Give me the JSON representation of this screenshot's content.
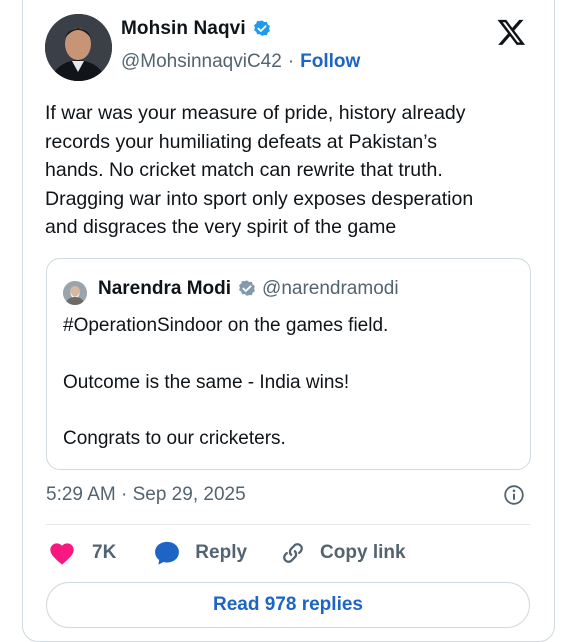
{
  "author": {
    "name": "Mohsin Naqvi",
    "handle": "@MohsinnaqviC42",
    "separator": "·",
    "follow_label": "Follow"
  },
  "tweet": {
    "lines": [
      "If war was your measure of pride, history already",
      "records your humiliating defeats at Pakistan’s",
      "hands. No cricket match can rewrite that truth.",
      "Dragging war into sport only exposes desperation",
      "and disgraces the very spirit of the game"
    ]
  },
  "quoted": {
    "name": "Narendra Modi",
    "handle": "@narendramodi",
    "lines": [
      "#OperationSindoor on the games field.",
      "Outcome is the same - India wins!",
      "Congrats to our cricketers."
    ]
  },
  "timestamp": "5:29 AM · Sep 29, 2025",
  "actions": {
    "likes": "7K",
    "reply_label": "Reply",
    "copy_label": "Copy link"
  },
  "read_replies_label": "Read 978 replies",
  "colors": {
    "accent": "#1d64c4",
    "verified": "#1d9bf0",
    "like": "#f91880",
    "muted": "#536471",
    "border": "#cfd9de"
  },
  "icons": [
    "verified-badge-icon",
    "x-logo-icon",
    "info-icon",
    "heart-icon",
    "reply-bubble-icon",
    "link-icon"
  ]
}
